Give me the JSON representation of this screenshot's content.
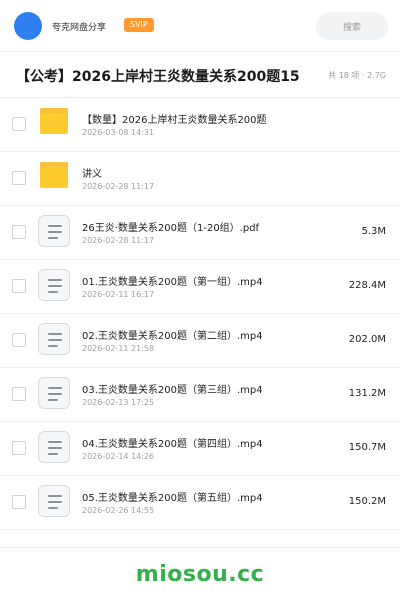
{
  "header": {
    "share_name": "夸克网盘分享",
    "badge": "SVIP",
    "search_label": "搜索"
  },
  "title": {
    "text": "【公考】2026上岸村王炎数量关系200题15",
    "meta": "共 18 项 · 2.7G"
  },
  "files": [
    {
      "type": "folder",
      "name": "【数量】2026上岸村王炎数量关系200题",
      "date": "2026-03-08 14:31",
      "size": ""
    },
    {
      "type": "folder",
      "name": "讲义",
      "date": "2026-02-28 11:17",
      "size": ""
    },
    {
      "type": "doc",
      "name": "26王炎·数量关系200题（1-20组）.pdf",
      "date": "2026-02-28 11:17",
      "size": "5.3M"
    },
    {
      "type": "doc",
      "name": "01.王炎数量关系200题（第一组）.mp4",
      "date": "2026-02-11 16:17",
      "size": "228.4M"
    },
    {
      "type": "doc",
      "name": "02.王炎数量关系200题（第二组）.mp4",
      "date": "2026-02-11 21:58",
      "size": "202.0M"
    },
    {
      "type": "doc",
      "name": "03.王炎数量关系200题（第三组）.mp4",
      "date": "2026-02-13 17:25",
      "size": "131.2M"
    },
    {
      "type": "doc",
      "name": "04.王炎数量关系200题（第四组）.mp4",
      "date": "2026-02-14 14:26",
      "size": "150.7M"
    },
    {
      "type": "doc",
      "name": "05.王炎数量关系200题（第五组）.mp4",
      "date": "2026-02-26 14:55",
      "size": "150.2M"
    }
  ],
  "footer": {
    "watermark": "miosou.cc"
  },
  "colors": {
    "avatar": "#2f7ff0",
    "badge": "#ff9a2e",
    "folder": "#ffcb2f",
    "watermark": "#33b04a"
  }
}
